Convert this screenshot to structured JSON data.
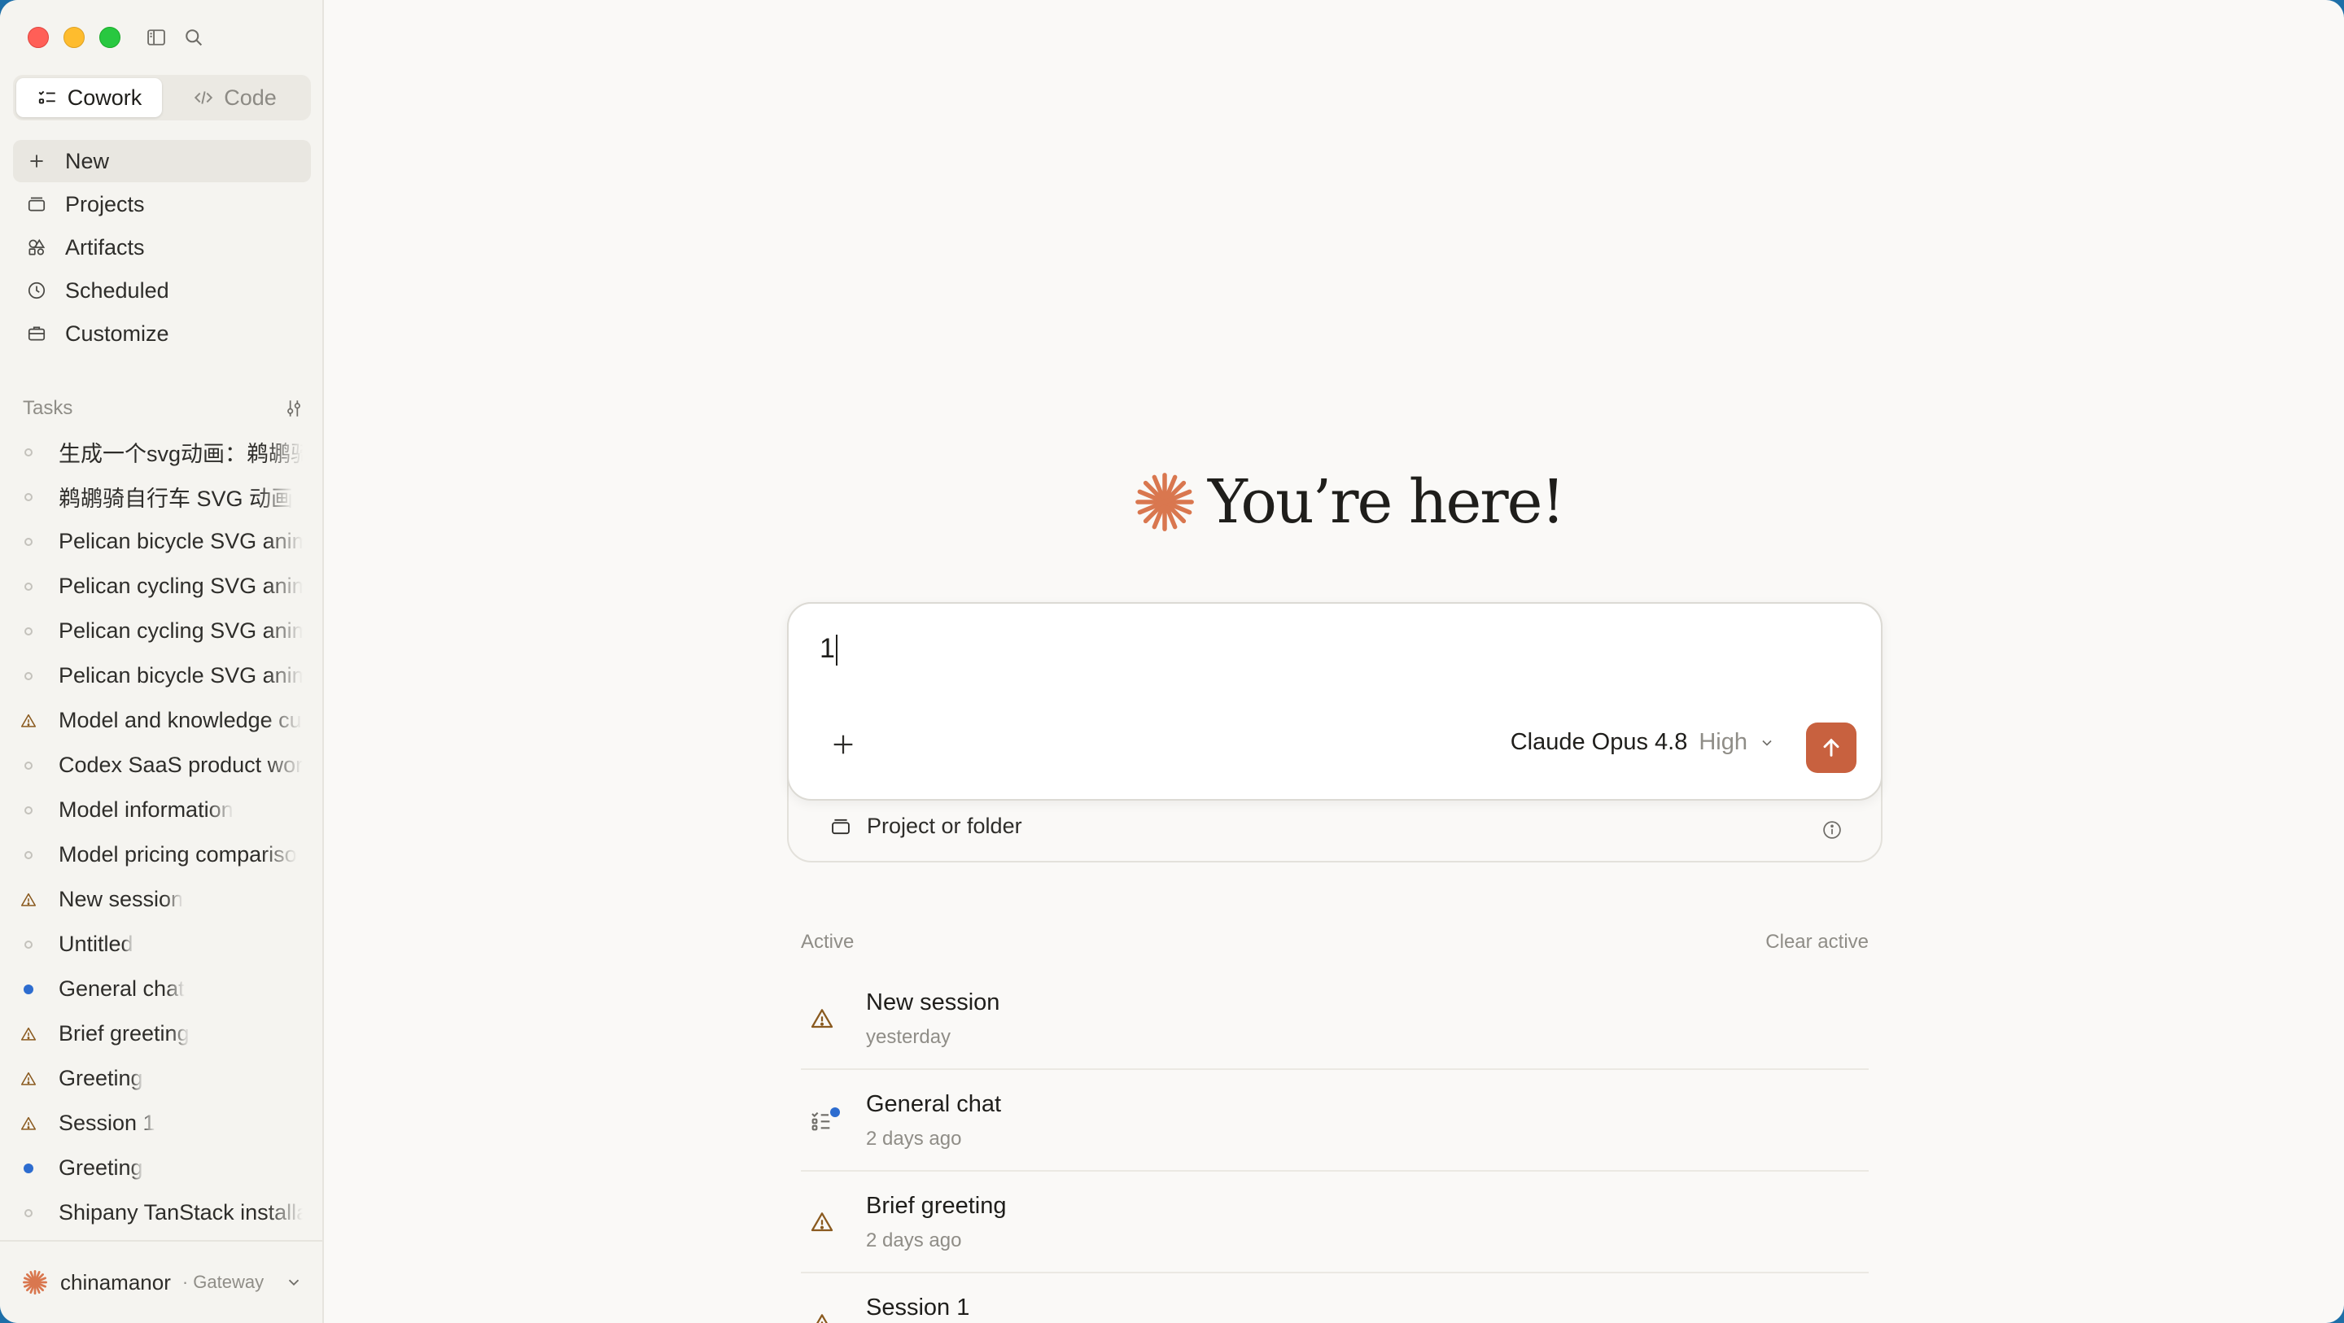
{
  "modes": {
    "cowork": "Cowork",
    "code": "Code"
  },
  "nav": {
    "new": "New",
    "projects": "Projects",
    "artifacts": "Artifacts",
    "scheduled": "Scheduled",
    "customize": "Customize"
  },
  "tasks": {
    "heading": "Tasks",
    "items": [
      {
        "label": "生成一个svg动画：鹈鹕骑",
        "status": "idle"
      },
      {
        "label": "鹈鹕骑自行车 SVG 动画",
        "status": "idle"
      },
      {
        "label": "Pelican bicycle SVG anim",
        "status": "idle"
      },
      {
        "label": "Pelican cycling SVG anim",
        "status": "idle"
      },
      {
        "label": "Pelican cycling SVG anim",
        "status": "idle"
      },
      {
        "label": "Pelican bicycle SVG anim",
        "status": "idle"
      },
      {
        "label": "Model and knowledge cu",
        "status": "warning"
      },
      {
        "label": "Codex SaaS product wor",
        "status": "idle"
      },
      {
        "label": "Model information",
        "status": "idle"
      },
      {
        "label": "Model pricing compariso",
        "status": "idle"
      },
      {
        "label": "New session",
        "status": "warning"
      },
      {
        "label": "Untitled",
        "status": "idle"
      },
      {
        "label": "General chat",
        "status": "active"
      },
      {
        "label": "Brief greeting",
        "status": "warning"
      },
      {
        "label": "Greeting",
        "status": "warning"
      },
      {
        "label": "Session 1",
        "status": "warning"
      },
      {
        "label": "Greeting",
        "status": "active"
      },
      {
        "label": "Shipany TanStack installa",
        "status": "idle"
      }
    ]
  },
  "user": {
    "name": "chinamanor",
    "sub": "· Gateway"
  },
  "hero": {
    "title": "You’re here!"
  },
  "composer": {
    "value": "1",
    "model": "Claude Opus 4.8",
    "effort": "High",
    "folder_label": "Project or folder"
  },
  "active": {
    "heading": "Active",
    "clear_label": "Clear active",
    "sessions": [
      {
        "title": "New session",
        "time": "yesterday",
        "icon": "warning-icon"
      },
      {
        "title": "General chat",
        "time": "2 days ago",
        "icon": "checklist-icon"
      },
      {
        "title": "Brief greeting",
        "time": "2 days ago",
        "icon": "warning-icon"
      },
      {
        "title": "Session 1",
        "time": "",
        "icon": "warning-icon"
      }
    ]
  },
  "colors": {
    "accent": "#c8613f",
    "status_blue": "#2d6ccf",
    "warning": "#8a5a1f"
  }
}
